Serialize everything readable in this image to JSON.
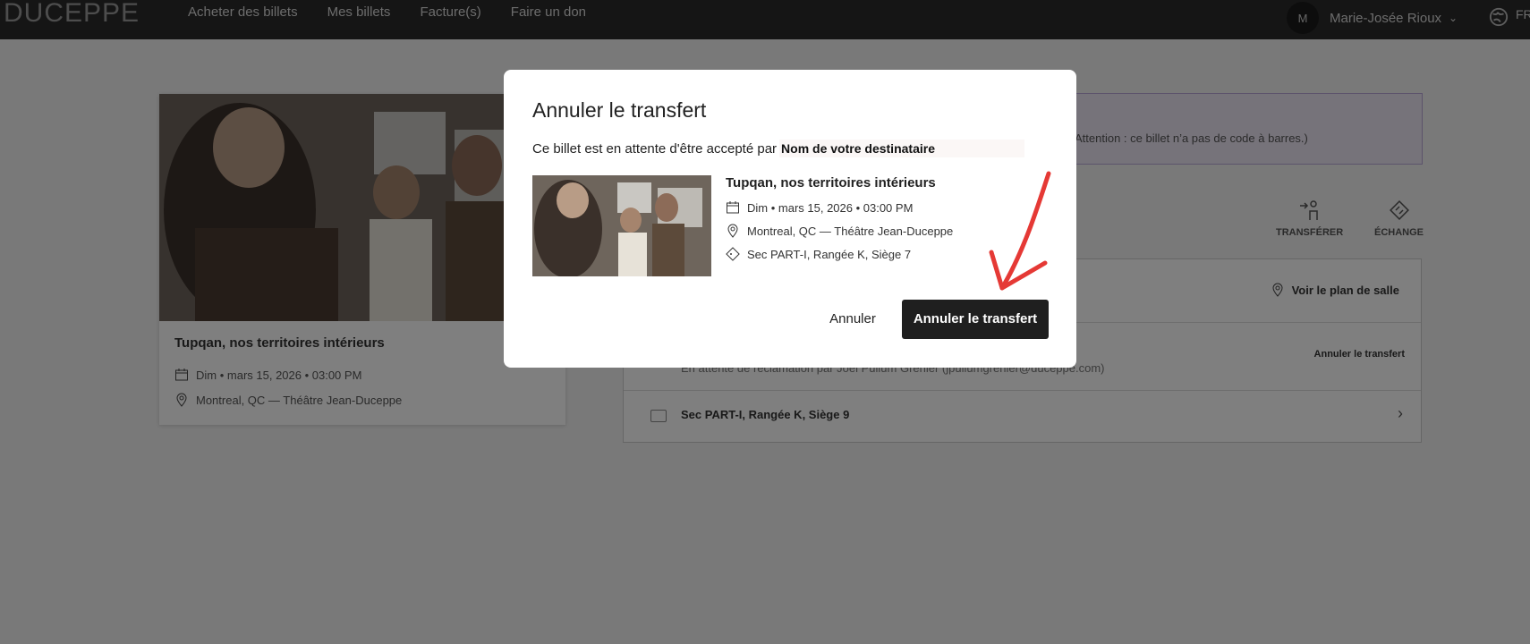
{
  "nav": {
    "logo": "DUCEPPE",
    "links": [
      "Acheter des billets",
      "Mes billets",
      "Facture(s)",
      "Faire un don"
    ],
    "avatar_initial": "M",
    "user_name": "Marie-Josée Rioux",
    "language": "FR"
  },
  "event": {
    "title": "Tupqan, nos territoires intérieurs",
    "date": "Dim • mars 15, 2026 • 03:00 PM",
    "venue": "Montreal, QC — Théâtre Jean-Duceppe"
  },
  "notice": {
    "text": "Attention : ce billet n’a pas de code à barres.)"
  },
  "actions": {
    "transfer": "TRANSFÉRER",
    "exchange": "ÉCHANGE"
  },
  "tickets": {
    "seat_map": "Voir le plan de salle",
    "pending_text": "En attente de réclamation par Joël Pullum Grenier (jpullumgrenier@duceppe.com)",
    "cancel_transfer_link": "Annuler le transfert",
    "seat9": "Sec PART-I, Rangée K, Siège 9"
  },
  "modal": {
    "title": "Annuler le transfert",
    "message": "Ce billet est en attente d'être accepté par",
    "recipient": "Nom de votre destinataire",
    "show_title": "Tupqan, nos territoires intérieurs",
    "date": "Dim • mars 15, 2026 • 03:00 PM",
    "venue": "Montreal, QC — Théâtre Jean-Duceppe",
    "seat": "Sec PART-I, Rangée K, Siège 7",
    "cancel_label": "Annuler",
    "confirm_label": "Annuler le transfert"
  },
  "colors": {
    "nav_bg": "#2b2b2b",
    "primary_button": "#1f1f1f",
    "annotation_arrow": "#e53935"
  }
}
